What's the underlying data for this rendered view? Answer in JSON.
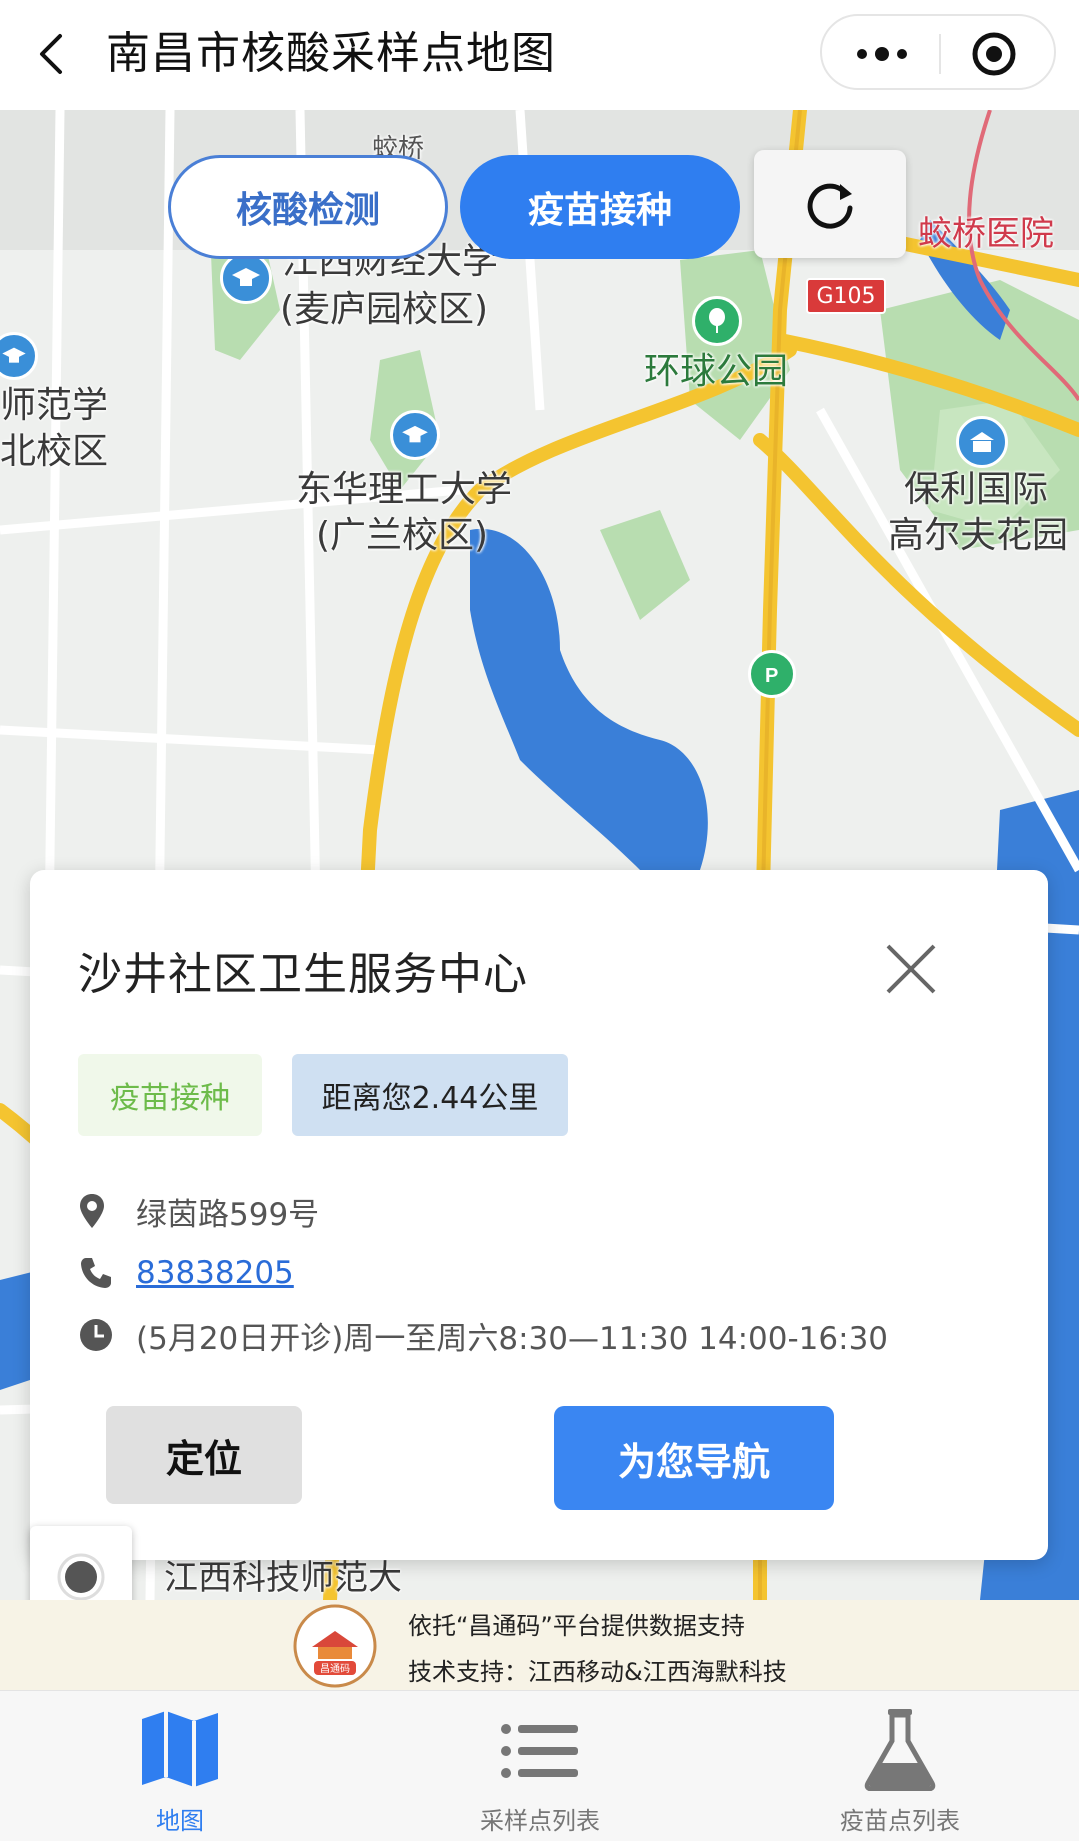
{
  "header": {
    "title": "南昌市核酸采样点地图",
    "back_icon": "chevron-left-icon",
    "more_icon": "more-dots-icon",
    "close_icon": "target-circle-icon"
  },
  "map": {
    "toggle_nucleic": "核酸检测",
    "toggle_vaccine": "疫苗接种",
    "active_toggle": "疫苗接种",
    "labels": {
      "jiaoqiao_top": "蛟桥",
      "jiaoqiao_hospital": "蛟桥医院",
      "g105": "G105",
      "jxufe_1": "江西财经大学",
      "jxufe_2": "(麦庐园校区)",
      "normal_1": "师范学",
      "normal_2": "北校区",
      "global_park": "环球公园",
      "ecut_1": "东华理工大学",
      "ecut_2": "(广兰校区)",
      "poly_1": "保利国际",
      "poly_2": "高尔夫花园",
      "jxstnu": "江西科技师范大"
    },
    "colors": {
      "road_main": "#f4c430",
      "road_minor": "#ffffff",
      "water": "#3a7fd8",
      "green": "#b8ddb0",
      "land": "#eef0ee"
    }
  },
  "card": {
    "name": "沙井社区卫生服务中心",
    "tag_type": "疫苗接种",
    "tag_distance": "距离您2.44公里",
    "address": "绿茵路599号",
    "phone": "83838205",
    "hours": "(5月20日开诊)周一至周六8:30—11:30 14:00-16:30",
    "btn_locate": "定位",
    "btn_navigate": "为您导航"
  },
  "banner": {
    "logo_text": "昌通码",
    "line1": "依托“昌通码”平台提供数据支持",
    "line2": "技术支持：江西移动&江西海默科技"
  },
  "tabs": [
    {
      "label": "地图",
      "icon": "map-icon",
      "active": true
    },
    {
      "label": "采样点列表",
      "icon": "list-icon",
      "active": false
    },
    {
      "label": "疫苗点列表",
      "icon": "flask-icon",
      "active": false
    }
  ]
}
